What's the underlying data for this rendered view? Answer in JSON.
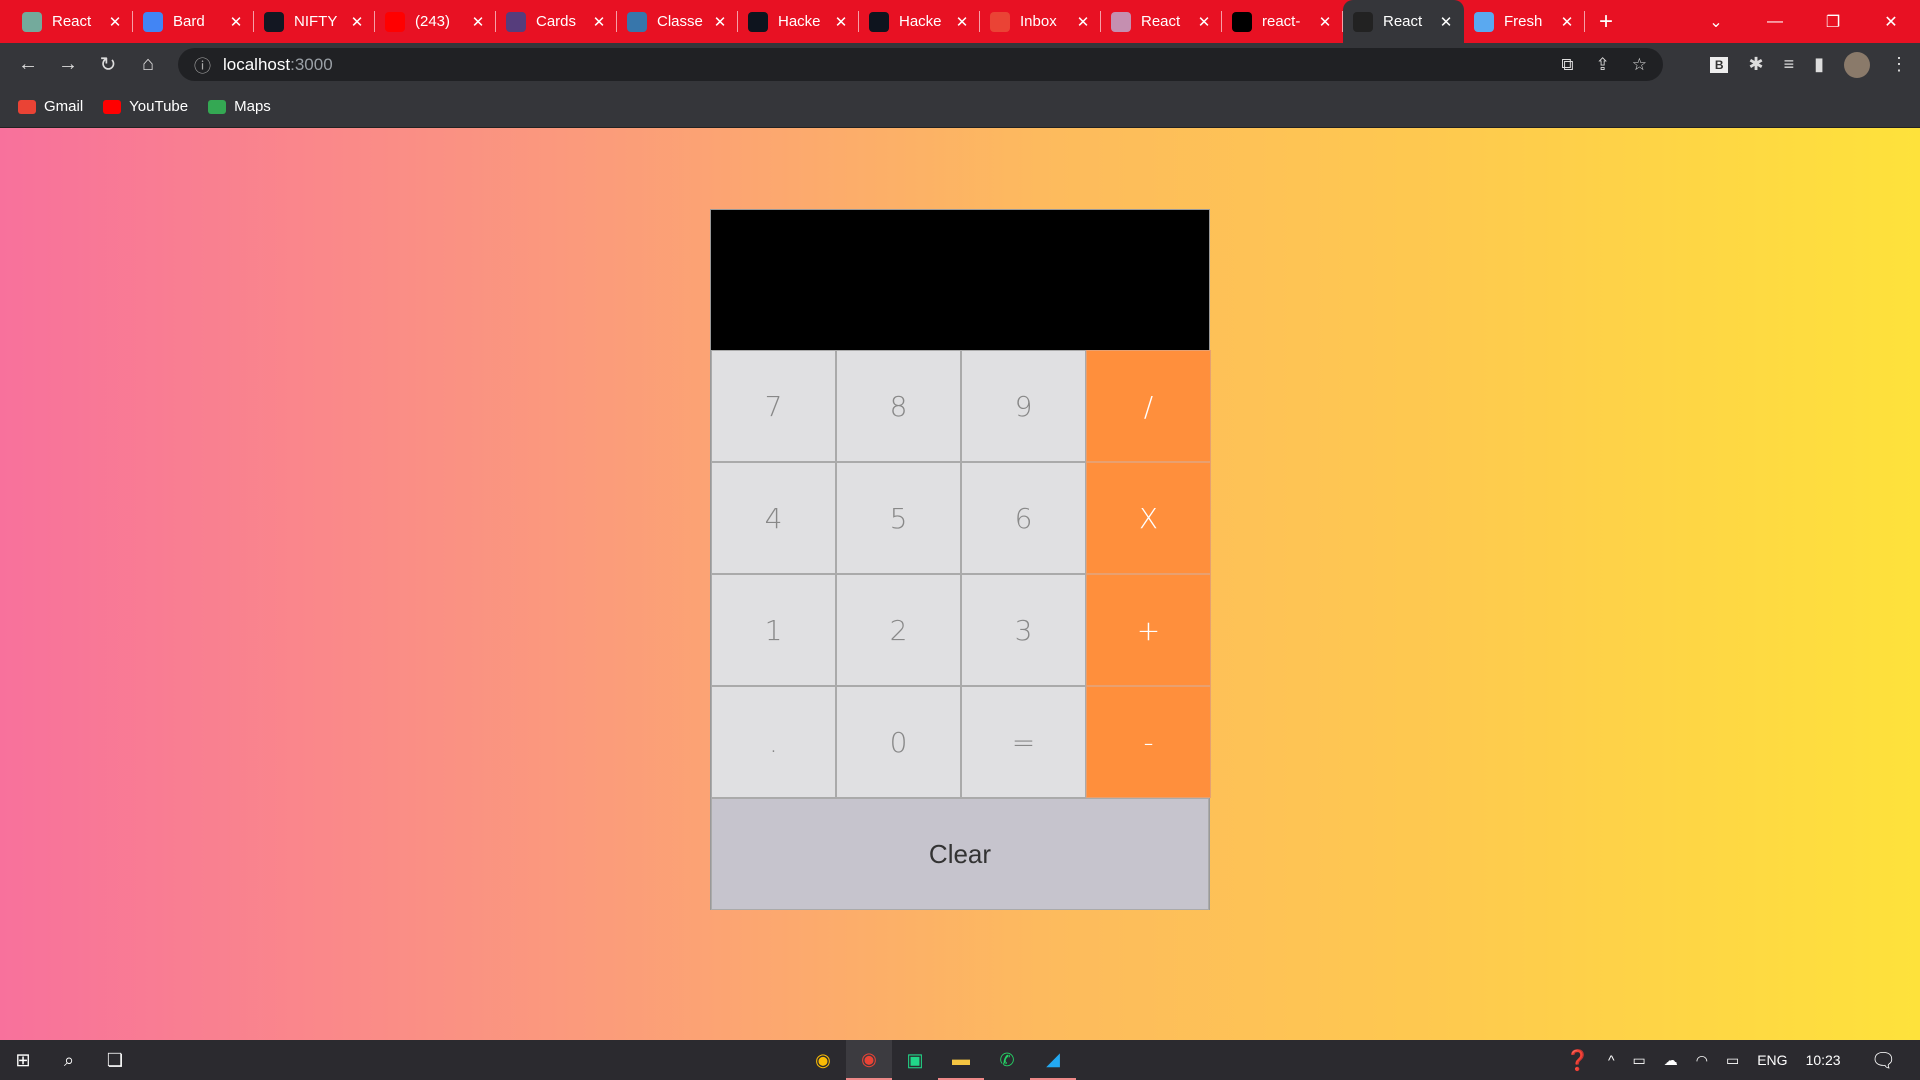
{
  "browser": {
    "tabs": [
      {
        "title": "React",
        "icon": "chatgpt-icon",
        "color": "#74aa9c"
      },
      {
        "title": "Bard",
        "icon": "bard-icon",
        "color": "#4285f4"
      },
      {
        "title": "NIFTY",
        "icon": "tradingview-icon",
        "color": "#131722"
      },
      {
        "title": "(243)",
        "icon": "youtube-icon",
        "color": "#ff0000"
      },
      {
        "title": "Cards",
        "icon": "bootstrap-icon",
        "color": "#563d7c"
      },
      {
        "title": "Classe",
        "icon": "python-icon",
        "color": "#3776ab"
      },
      {
        "title": "Hacke",
        "icon": "hackerrank-icon",
        "color": "#0e141e"
      },
      {
        "title": "Hacke",
        "icon": "hackerrank-icon",
        "color": "#0e141e"
      },
      {
        "title": "Inbox",
        "icon": "gmail-icon",
        "color": "#ea4335"
      },
      {
        "title": "React",
        "icon": "avatar-icon",
        "color": "#c58fb0"
      },
      {
        "title": "react-",
        "icon": "github-icon",
        "color": "#000000"
      },
      {
        "title": "React",
        "icon": "react-icon",
        "color": "#222"
      },
      {
        "title": "Fresh",
        "icon": "fresh-icon",
        "color": "#5aa9f0"
      }
    ],
    "active_tab": 11,
    "url_host": "localhost",
    "url_port": ":3000",
    "bookmarks": [
      {
        "label": "Gmail",
        "icon": "gmail-icon"
      },
      {
        "label": "YouTube",
        "icon": "youtube-icon"
      },
      {
        "label": "Maps",
        "icon": "maps-icon"
      }
    ]
  },
  "calculator": {
    "display": "",
    "keys": [
      "7",
      "8",
      "9",
      "/",
      "4",
      "5",
      "6",
      "X",
      "1",
      "2",
      "3",
      "+",
      ".",
      "0",
      "=",
      "-"
    ],
    "operator_color": "#ff8f3c",
    "clear_label": "Clear"
  },
  "taskbar": {
    "language": "ENG",
    "time": "10:23"
  }
}
